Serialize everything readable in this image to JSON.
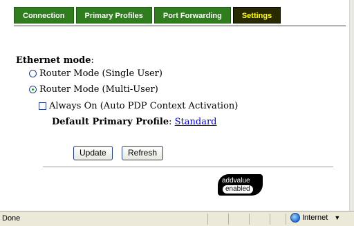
{
  "tabs": [
    {
      "label": "Connection"
    },
    {
      "label": "Primary Profiles"
    },
    {
      "label": "Port Forwarding"
    },
    {
      "label": "Settings",
      "active": true
    }
  ],
  "ethernet": {
    "heading": "Ethernet mode",
    "heading_suffix": ":",
    "options": [
      {
        "label": "Router Mode (Single User)",
        "checked": false
      },
      {
        "label": "Router Mode (Multi-User)",
        "checked": true
      }
    ],
    "always_on": {
      "label": "Always On (Auto PDP Context Activation)",
      "checked": false
    },
    "default_profile_label": "Default Primary Profile",
    "default_profile_sep": ": ",
    "default_profile_value": "Standard"
  },
  "buttons": {
    "update": "Update",
    "refresh": "Refresh"
  },
  "logo": {
    "line1": "addvalue",
    "line2": "enabled"
  },
  "statusbar": {
    "text": "Done",
    "zone": "Internet",
    "zone_icon": "globe-icon"
  },
  "colors": {
    "tab_bg": "#2f7d1f",
    "tab_active_bg": "#2a2a00",
    "tab_active_text": "#ffff00",
    "accent_line": "#9b1b1b"
  }
}
